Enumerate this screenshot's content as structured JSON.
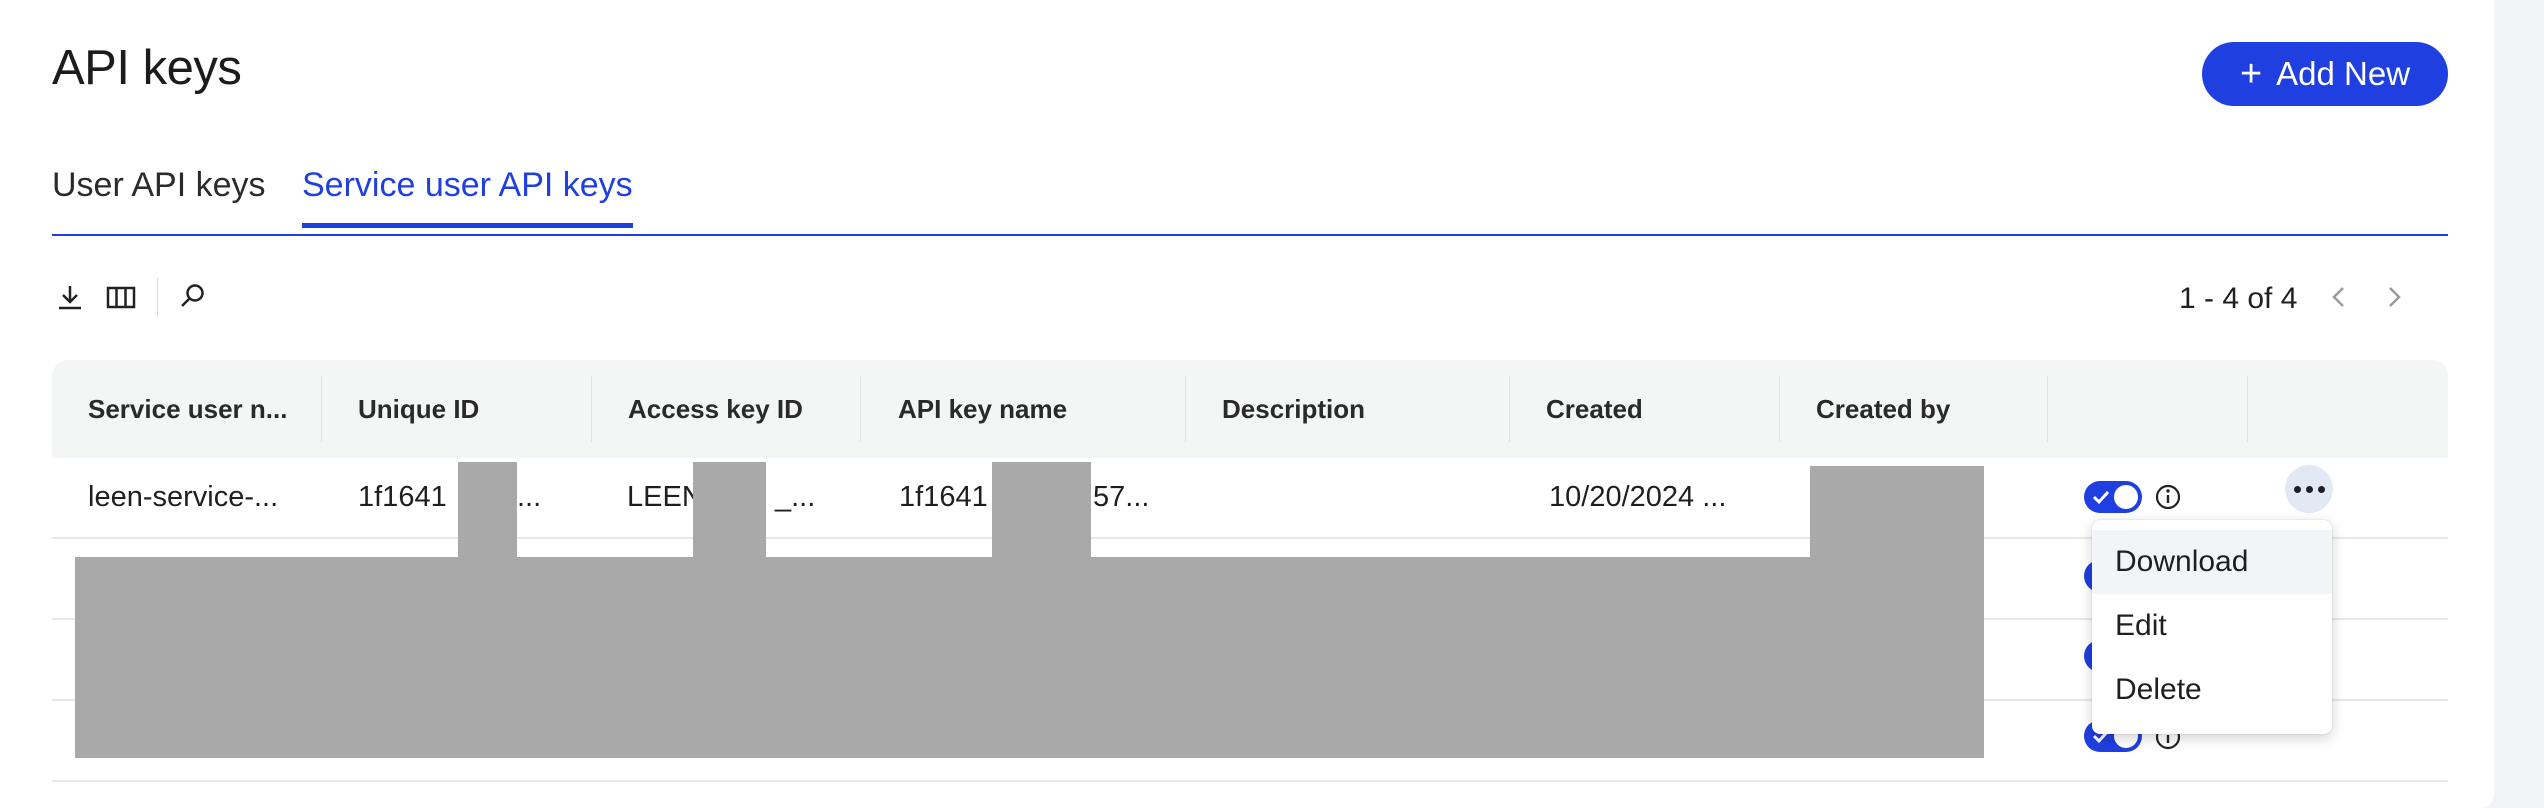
{
  "page": {
    "title": "API keys",
    "add_button_label": "Add New"
  },
  "tabs": [
    {
      "label": "User API keys",
      "active": false
    },
    {
      "label": "Service user API keys",
      "active": true
    }
  ],
  "toolbar": {
    "icons": [
      "download-icon",
      "columns-icon",
      "search-icon"
    ],
    "pagination_text": "1 - 4 of 4"
  },
  "table": {
    "columns": [
      "Service user n...",
      "Unique ID",
      "Access key ID",
      "API key name",
      "Description",
      "Created",
      "Created by",
      "",
      ""
    ],
    "rows": [
      {
        "service_user": "leen-service-...",
        "unique_id": "1f1641",
        "access_key_id": "LEEN",
        "access_key_id_tail": "_...",
        "api_key_name": "1f1641",
        "api_key_name_tail": "57...",
        "description": "",
        "created": "10/20/2024 ...",
        "created_by": "",
        "enabled": true
      }
    ]
  },
  "row_menu": {
    "items": [
      "Download",
      "Edit",
      "Delete"
    ]
  },
  "colors": {
    "accent": "#1f3fe0",
    "redaction": "#a9a9a9",
    "header_bg": "#f4f6f5"
  }
}
